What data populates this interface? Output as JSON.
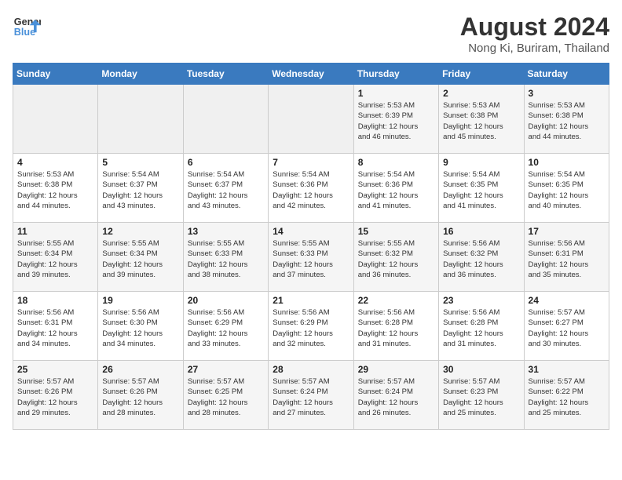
{
  "header": {
    "logo_line1": "General",
    "logo_line2": "Blue",
    "month_title": "August 2024",
    "location": "Nong Ki, Buriram, Thailand"
  },
  "days_of_week": [
    "Sunday",
    "Monday",
    "Tuesday",
    "Wednesday",
    "Thursday",
    "Friday",
    "Saturday"
  ],
  "weeks": [
    [
      {
        "day": "",
        "info": ""
      },
      {
        "day": "",
        "info": ""
      },
      {
        "day": "",
        "info": ""
      },
      {
        "day": "",
        "info": ""
      },
      {
        "day": "1",
        "info": "Sunrise: 5:53 AM\nSunset: 6:39 PM\nDaylight: 12 hours\nand 46 minutes."
      },
      {
        "day": "2",
        "info": "Sunrise: 5:53 AM\nSunset: 6:38 PM\nDaylight: 12 hours\nand 45 minutes."
      },
      {
        "day": "3",
        "info": "Sunrise: 5:53 AM\nSunset: 6:38 PM\nDaylight: 12 hours\nand 44 minutes."
      }
    ],
    [
      {
        "day": "4",
        "info": "Sunrise: 5:53 AM\nSunset: 6:38 PM\nDaylight: 12 hours\nand 44 minutes."
      },
      {
        "day": "5",
        "info": "Sunrise: 5:54 AM\nSunset: 6:37 PM\nDaylight: 12 hours\nand 43 minutes."
      },
      {
        "day": "6",
        "info": "Sunrise: 5:54 AM\nSunset: 6:37 PM\nDaylight: 12 hours\nand 43 minutes."
      },
      {
        "day": "7",
        "info": "Sunrise: 5:54 AM\nSunset: 6:36 PM\nDaylight: 12 hours\nand 42 minutes."
      },
      {
        "day": "8",
        "info": "Sunrise: 5:54 AM\nSunset: 6:36 PM\nDaylight: 12 hours\nand 41 minutes."
      },
      {
        "day": "9",
        "info": "Sunrise: 5:54 AM\nSunset: 6:35 PM\nDaylight: 12 hours\nand 41 minutes."
      },
      {
        "day": "10",
        "info": "Sunrise: 5:54 AM\nSunset: 6:35 PM\nDaylight: 12 hours\nand 40 minutes."
      }
    ],
    [
      {
        "day": "11",
        "info": "Sunrise: 5:55 AM\nSunset: 6:34 PM\nDaylight: 12 hours\nand 39 minutes."
      },
      {
        "day": "12",
        "info": "Sunrise: 5:55 AM\nSunset: 6:34 PM\nDaylight: 12 hours\nand 39 minutes."
      },
      {
        "day": "13",
        "info": "Sunrise: 5:55 AM\nSunset: 6:33 PM\nDaylight: 12 hours\nand 38 minutes."
      },
      {
        "day": "14",
        "info": "Sunrise: 5:55 AM\nSunset: 6:33 PM\nDaylight: 12 hours\nand 37 minutes."
      },
      {
        "day": "15",
        "info": "Sunrise: 5:55 AM\nSunset: 6:32 PM\nDaylight: 12 hours\nand 36 minutes."
      },
      {
        "day": "16",
        "info": "Sunrise: 5:56 AM\nSunset: 6:32 PM\nDaylight: 12 hours\nand 36 minutes."
      },
      {
        "day": "17",
        "info": "Sunrise: 5:56 AM\nSunset: 6:31 PM\nDaylight: 12 hours\nand 35 minutes."
      }
    ],
    [
      {
        "day": "18",
        "info": "Sunrise: 5:56 AM\nSunset: 6:31 PM\nDaylight: 12 hours\nand 34 minutes."
      },
      {
        "day": "19",
        "info": "Sunrise: 5:56 AM\nSunset: 6:30 PM\nDaylight: 12 hours\nand 34 minutes."
      },
      {
        "day": "20",
        "info": "Sunrise: 5:56 AM\nSunset: 6:29 PM\nDaylight: 12 hours\nand 33 minutes."
      },
      {
        "day": "21",
        "info": "Sunrise: 5:56 AM\nSunset: 6:29 PM\nDaylight: 12 hours\nand 32 minutes."
      },
      {
        "day": "22",
        "info": "Sunrise: 5:56 AM\nSunset: 6:28 PM\nDaylight: 12 hours\nand 31 minutes."
      },
      {
        "day": "23",
        "info": "Sunrise: 5:56 AM\nSunset: 6:28 PM\nDaylight: 12 hours\nand 31 minutes."
      },
      {
        "day": "24",
        "info": "Sunrise: 5:57 AM\nSunset: 6:27 PM\nDaylight: 12 hours\nand 30 minutes."
      }
    ],
    [
      {
        "day": "25",
        "info": "Sunrise: 5:57 AM\nSunset: 6:26 PM\nDaylight: 12 hours\nand 29 minutes."
      },
      {
        "day": "26",
        "info": "Sunrise: 5:57 AM\nSunset: 6:26 PM\nDaylight: 12 hours\nand 28 minutes."
      },
      {
        "day": "27",
        "info": "Sunrise: 5:57 AM\nSunset: 6:25 PM\nDaylight: 12 hours\nand 28 minutes."
      },
      {
        "day": "28",
        "info": "Sunrise: 5:57 AM\nSunset: 6:24 PM\nDaylight: 12 hours\nand 27 minutes."
      },
      {
        "day": "29",
        "info": "Sunrise: 5:57 AM\nSunset: 6:24 PM\nDaylight: 12 hours\nand 26 minutes."
      },
      {
        "day": "30",
        "info": "Sunrise: 5:57 AM\nSunset: 6:23 PM\nDaylight: 12 hours\nand 25 minutes."
      },
      {
        "day": "31",
        "info": "Sunrise: 5:57 AM\nSunset: 6:22 PM\nDaylight: 12 hours\nand 25 minutes."
      }
    ]
  ]
}
